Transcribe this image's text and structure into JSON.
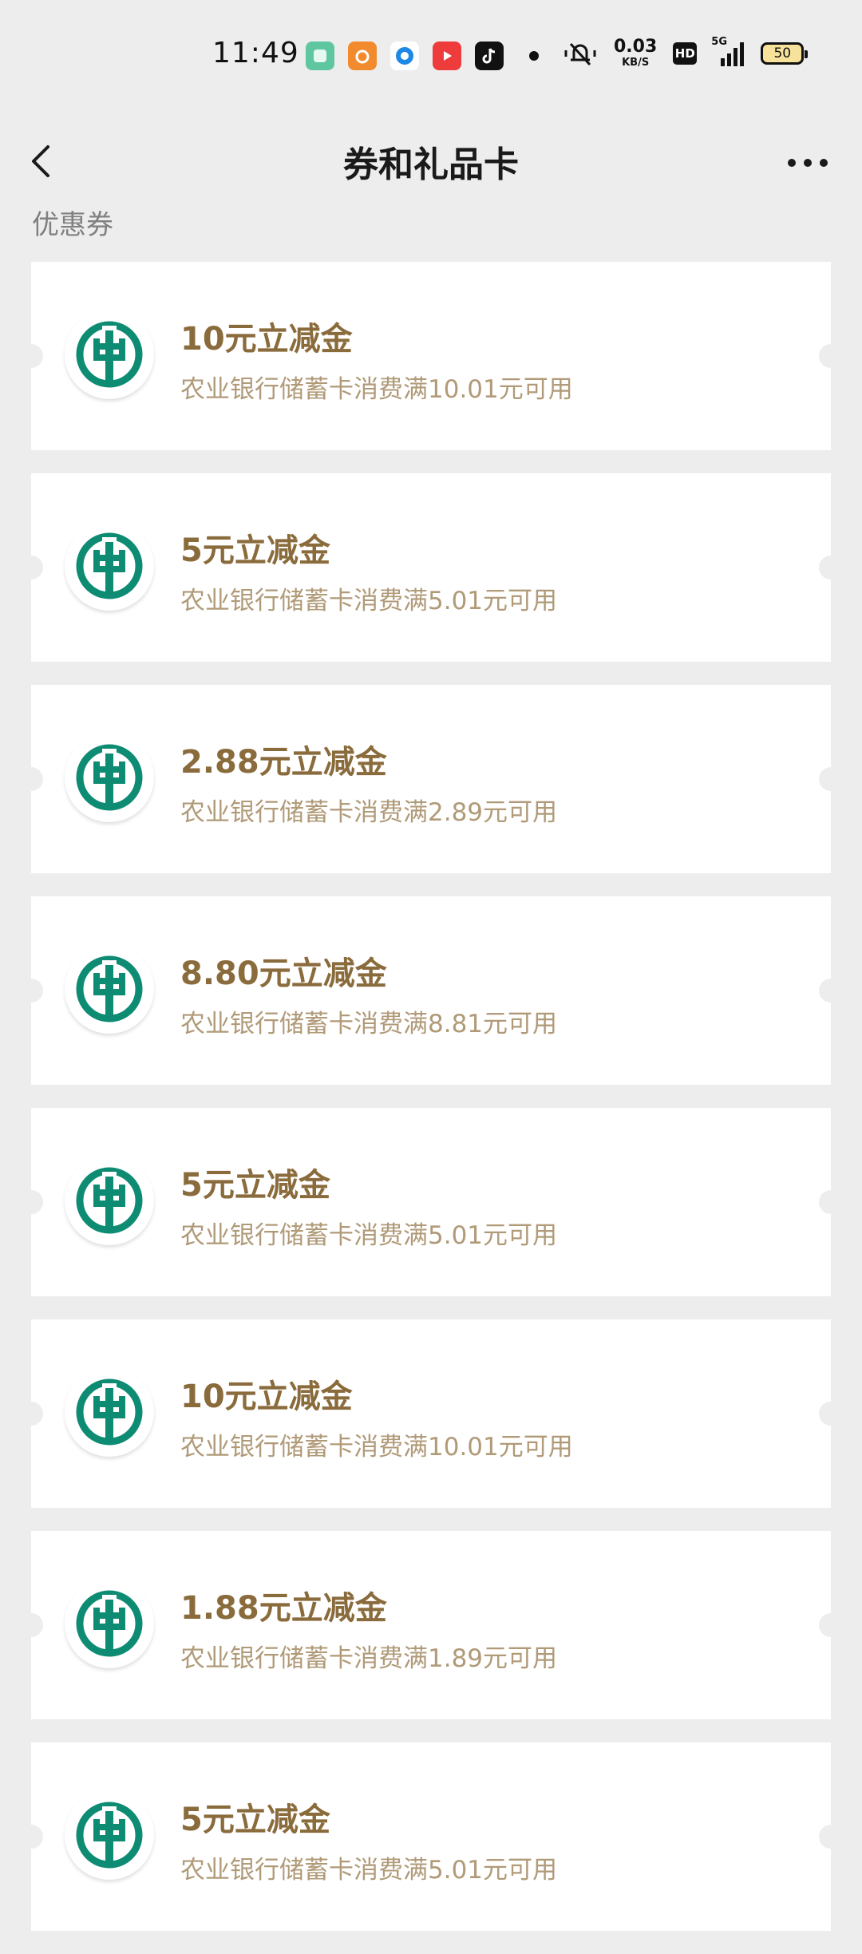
{
  "status_bar": {
    "time": "11:49",
    "network_speed_value": "0.03",
    "network_speed_unit": "KB/S",
    "hd_label": "HD",
    "network_type": "5G",
    "battery": "50"
  },
  "nav": {
    "title": "券和礼品卡"
  },
  "section": {
    "label": "优惠券"
  },
  "coupons": [
    {
      "title": "10元立减金",
      "desc": "农业银行储蓄卡消费满10.01元可用"
    },
    {
      "title": "5元立减金",
      "desc": "农业银行储蓄卡消费满5.01元可用"
    },
    {
      "title": "2.88元立减金",
      "desc": "农业银行储蓄卡消费满2.89元可用"
    },
    {
      "title": "8.80元立减金",
      "desc": "农业银行储蓄卡消费满8.81元可用"
    },
    {
      "title": "5元立减金",
      "desc": "农业银行储蓄卡消费满5.01元可用"
    },
    {
      "title": "10元立减金",
      "desc": "农业银行储蓄卡消费满10.01元可用"
    },
    {
      "title": "1.88元立减金",
      "desc": "农业银行储蓄卡消费满1.89元可用"
    },
    {
      "title": "5元立减金",
      "desc": "农业银行储蓄卡消费满5.01元可用"
    }
  ],
  "colors": {
    "background": "#ededed",
    "coupon_title": "#8a6b3c",
    "coupon_desc": "#b09a78",
    "abc_logo_green": "#0e8c73"
  },
  "icons": {
    "back": "chevron-left-icon",
    "more": "more-horizontal-icon",
    "coupon_logo": "agricultural-bank-logo-icon"
  }
}
